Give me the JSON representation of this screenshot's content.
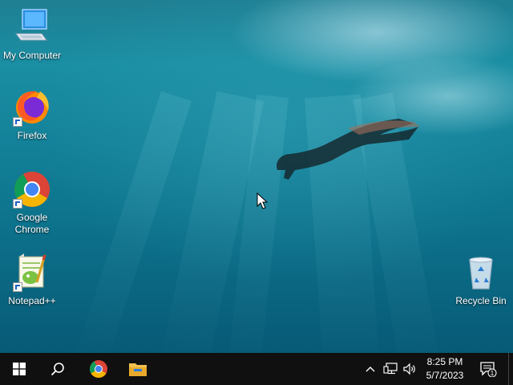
{
  "desktop": {
    "icons": [
      {
        "label": "My Computer",
        "icon": "computer-icon",
        "shortcut": false
      },
      {
        "label": "Firefox",
        "icon": "firefox-icon",
        "shortcut": true
      },
      {
        "label": "Google Chrome",
        "icon": "chrome-icon",
        "shortcut": true
      },
      {
        "label": "Notepad++",
        "icon": "notepadpp-icon",
        "shortcut": true
      },
      {
        "label": "Recycle Bin",
        "icon": "recycle-bin-icon",
        "shortcut": false
      }
    ]
  },
  "taskbar": {
    "start": "windows-logo-icon",
    "search": "search-icon",
    "pinned": [
      "chrome-icon",
      "file-explorer-icon"
    ],
    "tray": [
      "chevron-up-icon",
      "network-icon",
      "volume-icon"
    ],
    "clock": {
      "time": "8:25 PM",
      "date": "5/7/2023"
    },
    "notifications": {
      "icon": "action-center-icon",
      "count": "1"
    }
  },
  "colors": {
    "taskbar": "#101010",
    "water": "#15859c"
  }
}
